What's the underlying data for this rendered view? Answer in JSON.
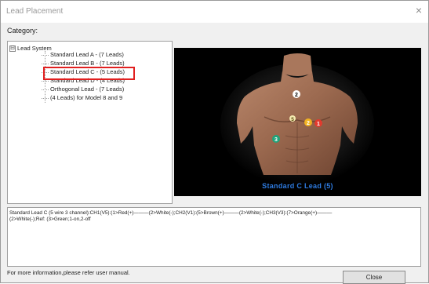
{
  "window": {
    "title": "Lead Placement",
    "close_glyph": "×"
  },
  "category": {
    "label": "Category:"
  },
  "tree": {
    "root": {
      "expander": "⊟",
      "label": "Lead System"
    },
    "items": [
      {
        "label": "Standard Lead A - (7 Leads)"
      },
      {
        "label": "Standard Lead B - (7 Leads)"
      },
      {
        "label": "Standard Lead C - (5 Leads)",
        "selected": true
      },
      {
        "label": "Standard Lead D - (4 Leads)"
      },
      {
        "label": "Orthogonal Lead - (7 Leads)"
      },
      {
        "label": "(4 Leads) for Model 8 and 9"
      }
    ]
  },
  "image": {
    "caption": "Standard  C  Lead (5)",
    "markers": [
      {
        "label": "2",
        "color": "#ffffff",
        "text_color": "#000000"
      },
      {
        "label": "5",
        "color": "#f3e9b0",
        "text_color": "#5a4a10"
      },
      {
        "label": "2",
        "color": "#f2b321",
        "text_color": "#ffffff"
      },
      {
        "label": "1",
        "color": "#e23a2e",
        "text_color": "#ffffff"
      },
      {
        "label": "3",
        "color": "#1fa37a",
        "text_color": "#ffffff"
      }
    ]
  },
  "info": {
    "line1": "Standard Lead C (5 wire 3 channel):CH1(V5):(1>Red(+)———(2>White(-);CH2(V1):(5>Brown(+)———(2>White(-);CH3(V3):(7>Orange(+)———",
    "line2": "(2>White(-);Ref: (3>Green;1-on,2-off"
  },
  "footer": {
    "note": "For more information,please refer user manual.",
    "close_label": "Close"
  },
  "colors": {
    "highlight": "#e12020",
    "caption": "#2e7be0",
    "image_bg": "#000000"
  }
}
